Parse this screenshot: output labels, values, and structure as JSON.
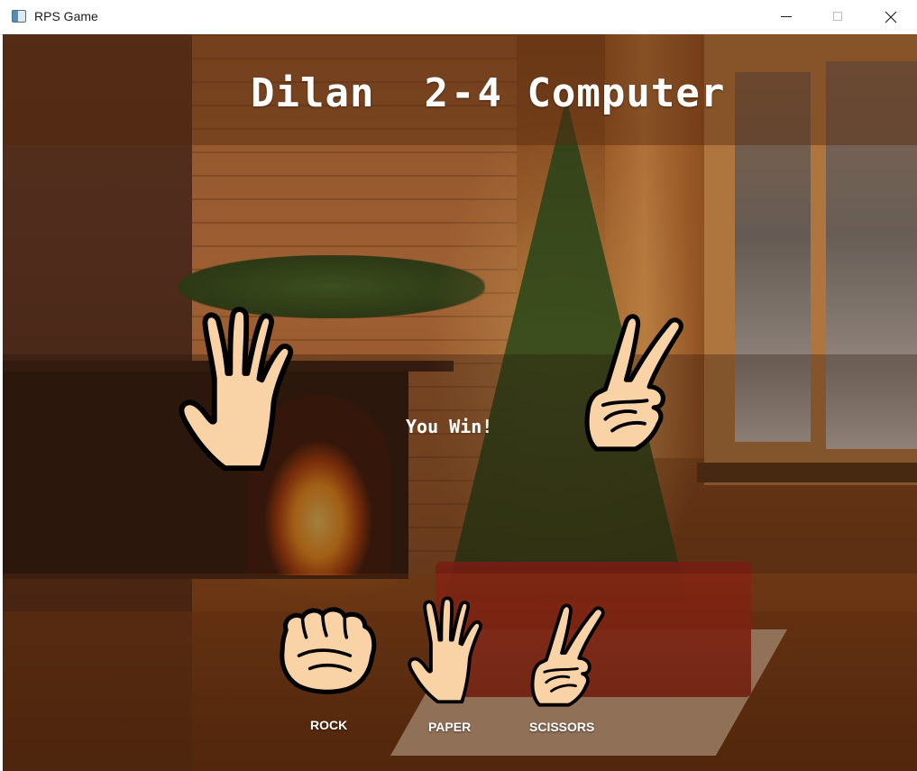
{
  "window": {
    "title": "RPS Game",
    "icon": "app-window-icon",
    "controls": {
      "minimize": "minimize-icon",
      "maximize": "maximize-icon",
      "close": "close-icon"
    }
  },
  "scoreboard": {
    "player_name": "Dilan",
    "player_score": "2",
    "separator": "-",
    "computer_score": "4",
    "computer_name": "Computer"
  },
  "round": {
    "player_hand": "paper",
    "computer_hand": "scissors",
    "result": "You Win!"
  },
  "choices": [
    {
      "id": "rock",
      "label": "ROCK",
      "icon": "rock-hand-icon"
    },
    {
      "id": "paper",
      "label": "PAPER",
      "icon": "paper-hand-icon"
    },
    {
      "id": "scissors",
      "label": "SCISSORS",
      "icon": "scissors-hand-icon"
    }
  ],
  "colors": {
    "skin": "#f9d3a6",
    "outline": "#000000",
    "text": "#ffffff",
    "overlay": "#50260c"
  }
}
